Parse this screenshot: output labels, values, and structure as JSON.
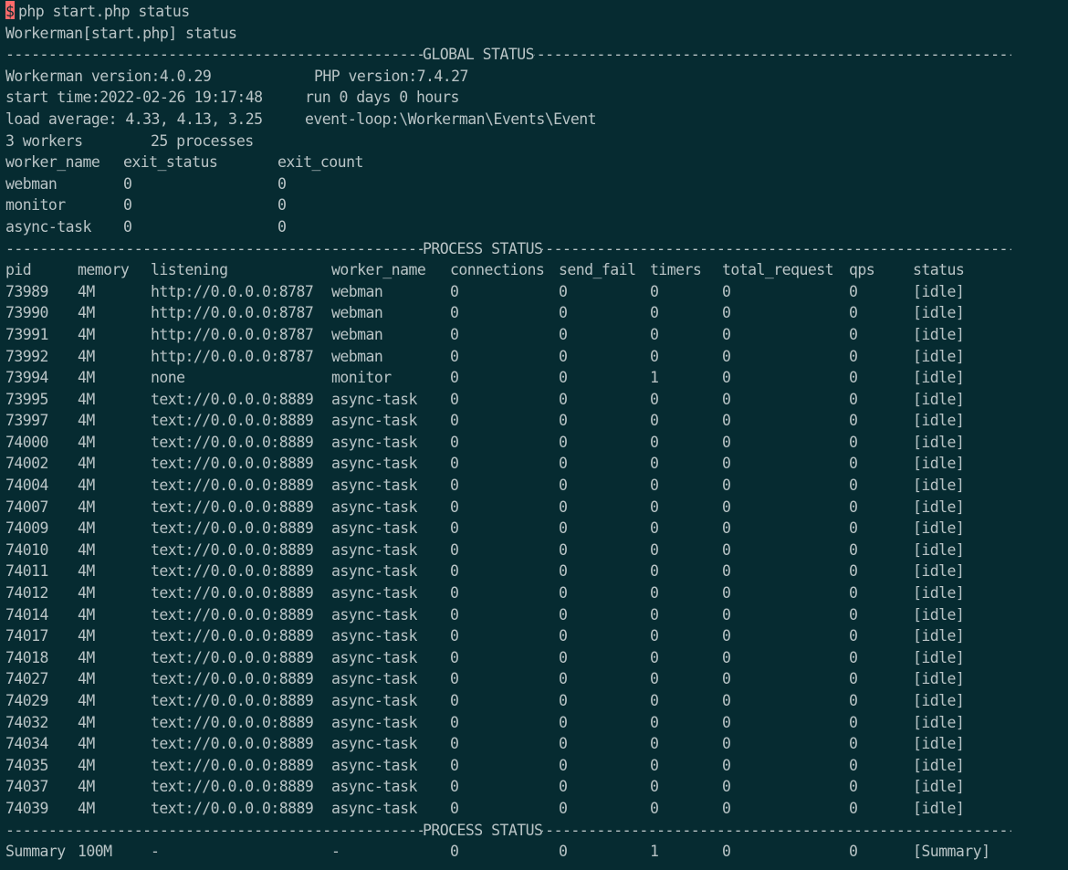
{
  "terminal": {
    "prompt_symbol": "$",
    "command": "php start.php status",
    "header": "Workerman[start.php] status",
    "global_label": "GLOBAL STATUS",
    "process_label": "PROCESS STATUS",
    "global": {
      "workerman_version": "Workerman version:4.0.29",
      "php_version": "PHP version:7.4.27",
      "start_time": "start time:2022-02-26 19:17:48",
      "run_time": "run 0 days 0 hours",
      "load_average": "load average: 4.33, 4.13, 3.25",
      "event_loop": "event-loop:\\Workerman\\Events\\Event",
      "workers": "3 workers",
      "processes": "25 processes"
    },
    "worker_table": {
      "headers": [
        "worker_name",
        "exit_status",
        "exit_count"
      ],
      "rows": [
        [
          "webman",
          "0",
          "0"
        ],
        [
          "monitor",
          "0",
          "0"
        ],
        [
          "async-task",
          "0",
          "0"
        ]
      ]
    },
    "process_table": {
      "headers": [
        "pid",
        "memory",
        "listening",
        "worker_name",
        "connections",
        "send_fail",
        "timers",
        "total_request",
        "qps",
        "status"
      ],
      "rows": [
        [
          "73989",
          "4M",
          "http://0.0.0.0:8787",
          "webman",
          "0",
          "0",
          "0",
          "0",
          "0",
          "[idle]"
        ],
        [
          "73990",
          "4M",
          "http://0.0.0.0:8787",
          "webman",
          "0",
          "0",
          "0",
          "0",
          "0",
          "[idle]"
        ],
        [
          "73991",
          "4M",
          "http://0.0.0.0:8787",
          "webman",
          "0",
          "0",
          "0",
          "0",
          "0",
          "[idle]"
        ],
        [
          "73992",
          "4M",
          "http://0.0.0.0:8787",
          "webman",
          "0",
          "0",
          "0",
          "0",
          "0",
          "[idle]"
        ],
        [
          "73994",
          "4M",
          "none",
          "monitor",
          "0",
          "0",
          "1",
          "0",
          "0",
          "[idle]"
        ],
        [
          "73995",
          "4M",
          "text://0.0.0.0:8889",
          "async-task",
          "0",
          "0",
          "0",
          "0",
          "0",
          "[idle]"
        ],
        [
          "73997",
          "4M",
          "text://0.0.0.0:8889",
          "async-task",
          "0",
          "0",
          "0",
          "0",
          "0",
          "[idle]"
        ],
        [
          "74000",
          "4M",
          "text://0.0.0.0:8889",
          "async-task",
          "0",
          "0",
          "0",
          "0",
          "0",
          "[idle]"
        ],
        [
          "74002",
          "4M",
          "text://0.0.0.0:8889",
          "async-task",
          "0",
          "0",
          "0",
          "0",
          "0",
          "[idle]"
        ],
        [
          "74004",
          "4M",
          "text://0.0.0.0:8889",
          "async-task",
          "0",
          "0",
          "0",
          "0",
          "0",
          "[idle]"
        ],
        [
          "74007",
          "4M",
          "text://0.0.0.0:8889",
          "async-task",
          "0",
          "0",
          "0",
          "0",
          "0",
          "[idle]"
        ],
        [
          "74009",
          "4M",
          "text://0.0.0.0:8889",
          "async-task",
          "0",
          "0",
          "0",
          "0",
          "0",
          "[idle]"
        ],
        [
          "74010",
          "4M",
          "text://0.0.0.0:8889",
          "async-task",
          "0",
          "0",
          "0",
          "0",
          "0",
          "[idle]"
        ],
        [
          "74011",
          "4M",
          "text://0.0.0.0:8889",
          "async-task",
          "0",
          "0",
          "0",
          "0",
          "0",
          "[idle]"
        ],
        [
          "74012",
          "4M",
          "text://0.0.0.0:8889",
          "async-task",
          "0",
          "0",
          "0",
          "0",
          "0",
          "[idle]"
        ],
        [
          "74014",
          "4M",
          "text://0.0.0.0:8889",
          "async-task",
          "0",
          "0",
          "0",
          "0",
          "0",
          "[idle]"
        ],
        [
          "74017",
          "4M",
          "text://0.0.0.0:8889",
          "async-task",
          "0",
          "0",
          "0",
          "0",
          "0",
          "[idle]"
        ],
        [
          "74018",
          "4M",
          "text://0.0.0.0:8889",
          "async-task",
          "0",
          "0",
          "0",
          "0",
          "0",
          "[idle]"
        ],
        [
          "74027",
          "4M",
          "text://0.0.0.0:8889",
          "async-task",
          "0",
          "0",
          "0",
          "0",
          "0",
          "[idle]"
        ],
        [
          "74029",
          "4M",
          "text://0.0.0.0:8889",
          "async-task",
          "0",
          "0",
          "0",
          "0",
          "0",
          "[idle]"
        ],
        [
          "74032",
          "4M",
          "text://0.0.0.0:8889",
          "async-task",
          "0",
          "0",
          "0",
          "0",
          "0",
          "[idle]"
        ],
        [
          "74034",
          "4M",
          "text://0.0.0.0:8889",
          "async-task",
          "0",
          "0",
          "0",
          "0",
          "0",
          "[idle]"
        ],
        [
          "74035",
          "4M",
          "text://0.0.0.0:8889",
          "async-task",
          "0",
          "0",
          "0",
          "0",
          "0",
          "[idle]"
        ],
        [
          "74037",
          "4M",
          "text://0.0.0.0:8889",
          "async-task",
          "0",
          "0",
          "0",
          "0",
          "0",
          "[idle]"
        ],
        [
          "74039",
          "4M",
          "text://0.0.0.0:8889",
          "async-task",
          "0",
          "0",
          "0",
          "0",
          "0",
          "[idle]"
        ]
      ],
      "summary": [
        "Summary",
        "100M",
        "-",
        "-",
        "0",
        "0",
        "1",
        "0",
        "0",
        "[Summary]"
      ]
    }
  }
}
